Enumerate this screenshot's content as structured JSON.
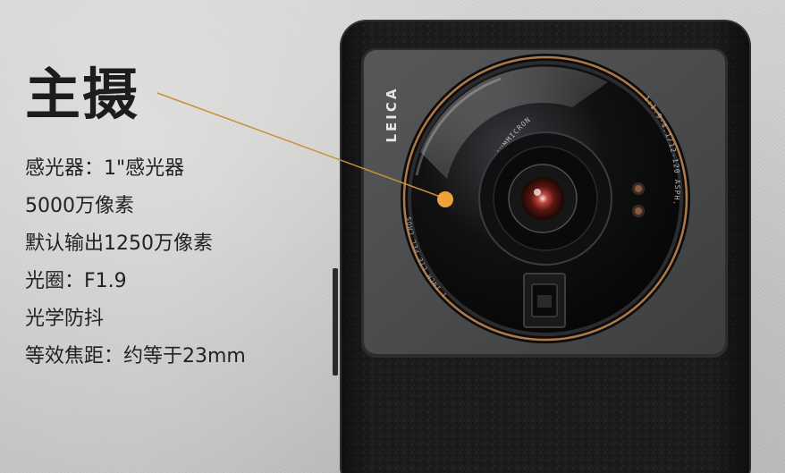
{
  "heading": "主摄",
  "specs": [
    "感光器：1\"感光器",
    "5000万像素",
    "默认输出1250万像素",
    "光圈：F1.9",
    "光学防抖",
    "等效焦距：约等于23mm"
  ],
  "lens_markings": {
    "brand": "LEICA",
    "upper_ring": "1:1.9-4.1/12-120 ASPH.",
    "lower_ring": "VARIO-SUMMICRON",
    "left_ring": "1 INCH LIE PEL CMOS"
  },
  "colors": {
    "callout_line": "#c8903a",
    "callout_dot": "#f0a23a",
    "lens_ring": "#b07a48",
    "heading_text": "#1d1d1d",
    "body_text": "#222222"
  }
}
